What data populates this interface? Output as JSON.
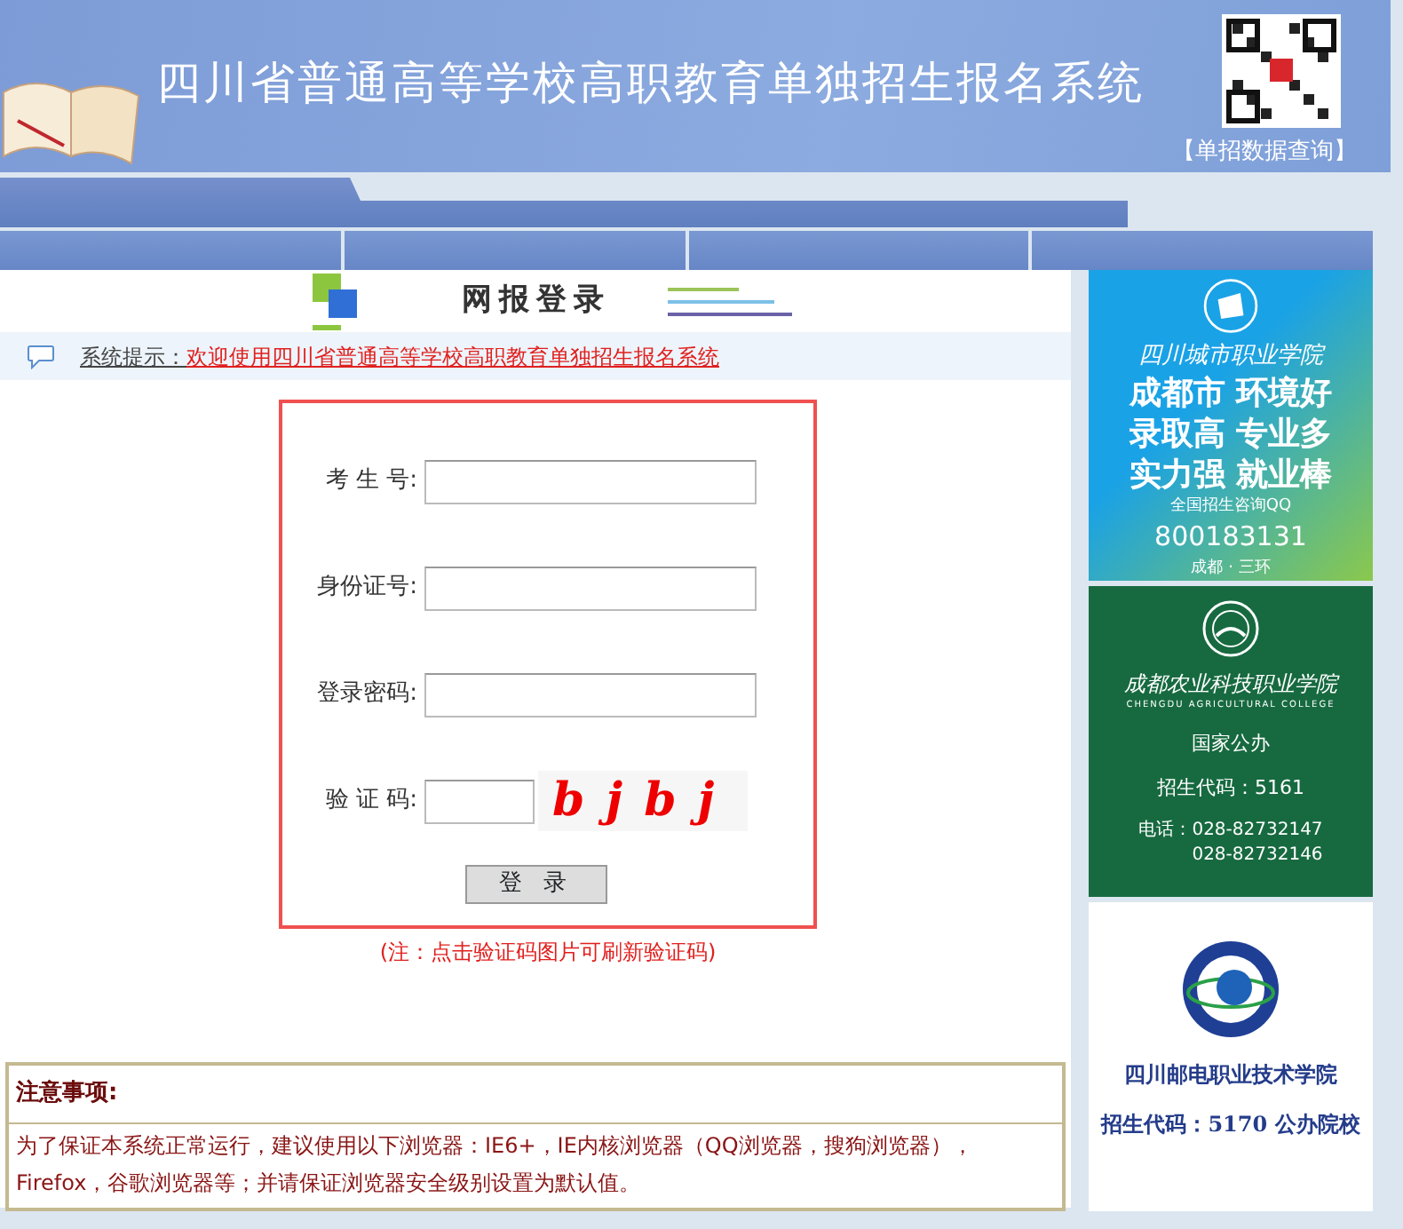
{
  "header": {
    "title": "四川省普通高等学校高职教育单独招生报名系统",
    "query_link": "【单招数据查询】"
  },
  "page_heading": "网报登录",
  "notice": {
    "label": "系统提示：",
    "message": "欢迎使用四川省普通高等学校高职教育单独招生报名系统"
  },
  "form": {
    "fields": [
      {
        "label": "考 生 号:",
        "kind": "text"
      },
      {
        "label": "身份证号:",
        "kind": "text"
      },
      {
        "label": "登录密码:",
        "kind": "password"
      },
      {
        "label": "验 证 码:",
        "kind": "captcha"
      }
    ],
    "captcha": "bjbj",
    "button": "登 录",
    "note": "(注：点击验证码图片可刷新验证码)"
  },
  "instructions": {
    "title": "注意事项:",
    "text": "为了保证本系统正常运行，建议使用以下浏览器：IE6+，IE内核浏览器（QQ浏览器，搜狗浏览器），Firefox，谷歌浏览器等；并请保证浏览器安全级别设置为默认值。"
  },
  "ads": [
    {
      "kind": "city",
      "name": "四川城市职业学院",
      "lines": [
        "成都市 环境好",
        "录取高 专业多",
        "实力强 就业棒"
      ],
      "qq_label": "全国招生咨询QQ",
      "qq": "800183131",
      "place": "成都 · 三环"
    },
    {
      "kind": "agri",
      "name": "成都农业科技职业学院",
      "subtitle": "CHENGDU AGRICULTURAL COLLEGE",
      "lines": [
        "国家公办",
        "招生代码：5161"
      ],
      "phone_label": "电话：",
      "phones": [
        "028-82732147",
        "028-82732146"
      ]
    },
    {
      "kind": "post",
      "name": "四川邮电职业技术学院",
      "lines": [
        "招生代码：5170 公办院校"
      ]
    }
  ]
}
